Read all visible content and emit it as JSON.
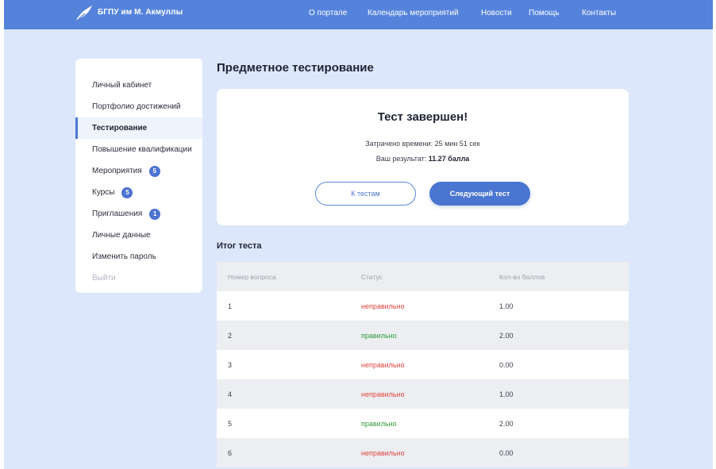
{
  "header": {
    "logo_text": "БГПУ им М. Акмуллы",
    "nav": [
      "О портале",
      "Календарь мероприятий",
      "Новости",
      "Помощь",
      "Контакты"
    ]
  },
  "sidebar": {
    "items": [
      {
        "label": "Личный кабинет",
        "badge": null,
        "active": false
      },
      {
        "label": "Портфолио достижений",
        "badge": null,
        "active": false
      },
      {
        "label": "Тестирование",
        "badge": null,
        "active": true
      },
      {
        "label": "Повышение квалификации",
        "badge": null,
        "active": false
      },
      {
        "label": "Мероприятия",
        "badge": "5",
        "active": false
      },
      {
        "label": "Курсы",
        "badge": "5",
        "active": false
      },
      {
        "label": "Приглашения",
        "badge": "1",
        "active": false
      },
      {
        "label": "Личные данные",
        "badge": null,
        "active": false
      },
      {
        "label": "Изменить пароль",
        "badge": null,
        "active": false
      },
      {
        "label": "Выйти",
        "badge": null,
        "active": false,
        "muted": true
      }
    ]
  },
  "main": {
    "title": "Предметное тестирование",
    "result": {
      "heading": "Тест завершен!",
      "time_label": "Затрачено времени:",
      "time_value": "25 мин 51 сек",
      "score_label": "Ваш результат:",
      "score_value": "11.27 балла",
      "back_button": "К тестам",
      "next_button": "Следующий тест"
    },
    "summary_title": "Итог теста",
    "table": {
      "columns": [
        "Номер вопроса",
        "Статус",
        "Кол-во баллов"
      ],
      "rows": [
        {
          "num": "1",
          "status": "неправильно",
          "correct": false,
          "points": "1.00"
        },
        {
          "num": "2",
          "status": "правильно",
          "correct": true,
          "points": "2.00"
        },
        {
          "num": "3",
          "status": "неправильно",
          "correct": false,
          "points": "0.00"
        },
        {
          "num": "4",
          "status": "неправильно",
          "correct": false,
          "points": "1.00"
        },
        {
          "num": "5",
          "status": "правильно",
          "correct": true,
          "points": "2.00"
        },
        {
          "num": "6",
          "status": "неправильно",
          "correct": false,
          "points": "0.00"
        }
      ]
    }
  },
  "colors": {
    "header": "#5583dc",
    "background": "#dce7fb",
    "accent": "#4a76d2",
    "wrong": "#e0463f",
    "right": "#2e9a3c"
  },
  "icons": {
    "logo": "feather-quill-icon"
  }
}
